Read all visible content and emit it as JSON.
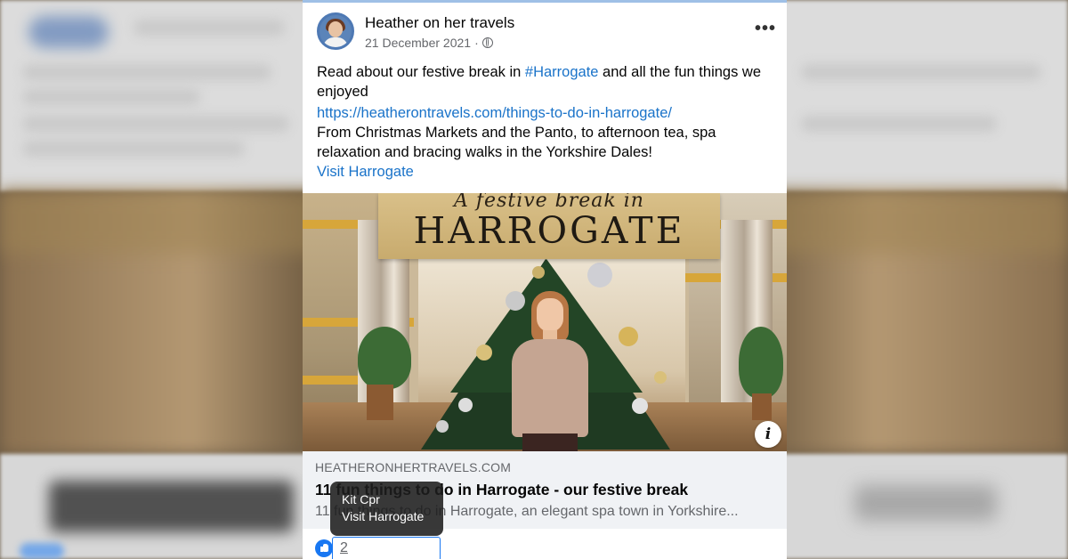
{
  "post": {
    "page_name": "Heather on her travels",
    "date": "21 December 2021",
    "date_separator": "·",
    "privacy_icon": "globe-icon",
    "more_icon": "more-options-icon",
    "more_label": "•••",
    "text_line1_before": "Read about our festive break in ",
    "hashtag": "#Harrogate",
    "text_line1_after": " and all the fun things we enjoyed",
    "url": "https://heatherontravels.com/things-to-do-in-harrogate/",
    "text_line2": "From Christmas Markets and the Panto, to afternoon tea, spa relaxation and bracing walks in the Yorkshire Dales!",
    "mention": "Visit Harrogate"
  },
  "preview": {
    "banner_line1": "A festive break in",
    "banner_line2": "HARROGATE",
    "info_icon": "info-icon",
    "info_label": "i",
    "domain": "HEATHERONHERTRAVELS.COM",
    "title": "11 fun things to do in Harrogate - our festive break",
    "description": "11 fun things to do in Harrogate, an elegant spa town in Yorkshire..."
  },
  "reactions": {
    "icon": "like-icon",
    "count": "2"
  },
  "tooltip": {
    "line1": "Kit Cpr",
    "line2": "Visit Harrogate"
  },
  "colors": {
    "link": "#1a73c9",
    "like": "#1877f2",
    "link_box_bg": "#f0f2f5"
  }
}
